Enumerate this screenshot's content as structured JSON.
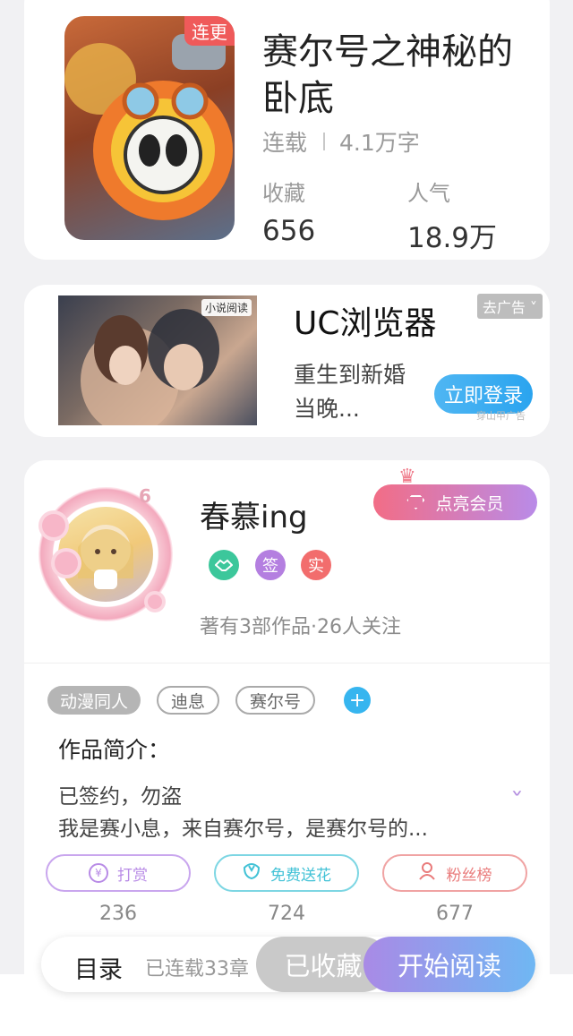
{
  "book": {
    "cover_badge": "连更",
    "title": "赛尔号之神秘的卧底",
    "status": "连载",
    "word_count": "4.1万字",
    "favorites_label": "收藏",
    "favorites_value": "656",
    "popularity_label": "人气",
    "popularity_value": "18.9万"
  },
  "ad": {
    "image_tag": "小说阅读",
    "title": "UC浏览器",
    "description": "重生到新婚当晚...",
    "close_label": "去广告",
    "login_button": "立即登录",
    "fine_print": "穿山甲广告"
  },
  "author": {
    "level": "6",
    "name": "春慕ing",
    "vip_button": "点亮会员",
    "badges": [
      {
        "label": "",
        "color": "#3cc79b"
      },
      {
        "label": "签",
        "color": "#b47fe0"
      },
      {
        "label": "实",
        "color": "#f26d6d"
      }
    ],
    "stats": "著有3部作品·26人关注"
  },
  "tags": [
    "动漫同人",
    "迪息",
    "赛尔号"
  ],
  "intro": {
    "heading": "作品简介：",
    "line1": "已签约，勿盗",
    "line2": "我是赛小息，来自赛尔号，是赛尔号的..."
  },
  "actions": [
    {
      "label": "打赏",
      "count": "236",
      "color": "#b88be6"
    },
    {
      "label": "免费送花",
      "count": "724",
      "color": "#42c2d6"
    },
    {
      "label": "粉丝榜",
      "count": "677",
      "color": "#e97b7b"
    }
  ],
  "bottom_bar": {
    "toc_label": "目录",
    "toc_status": "已连载33章",
    "favorite_button": "已收藏",
    "read_button": "开始阅读"
  }
}
